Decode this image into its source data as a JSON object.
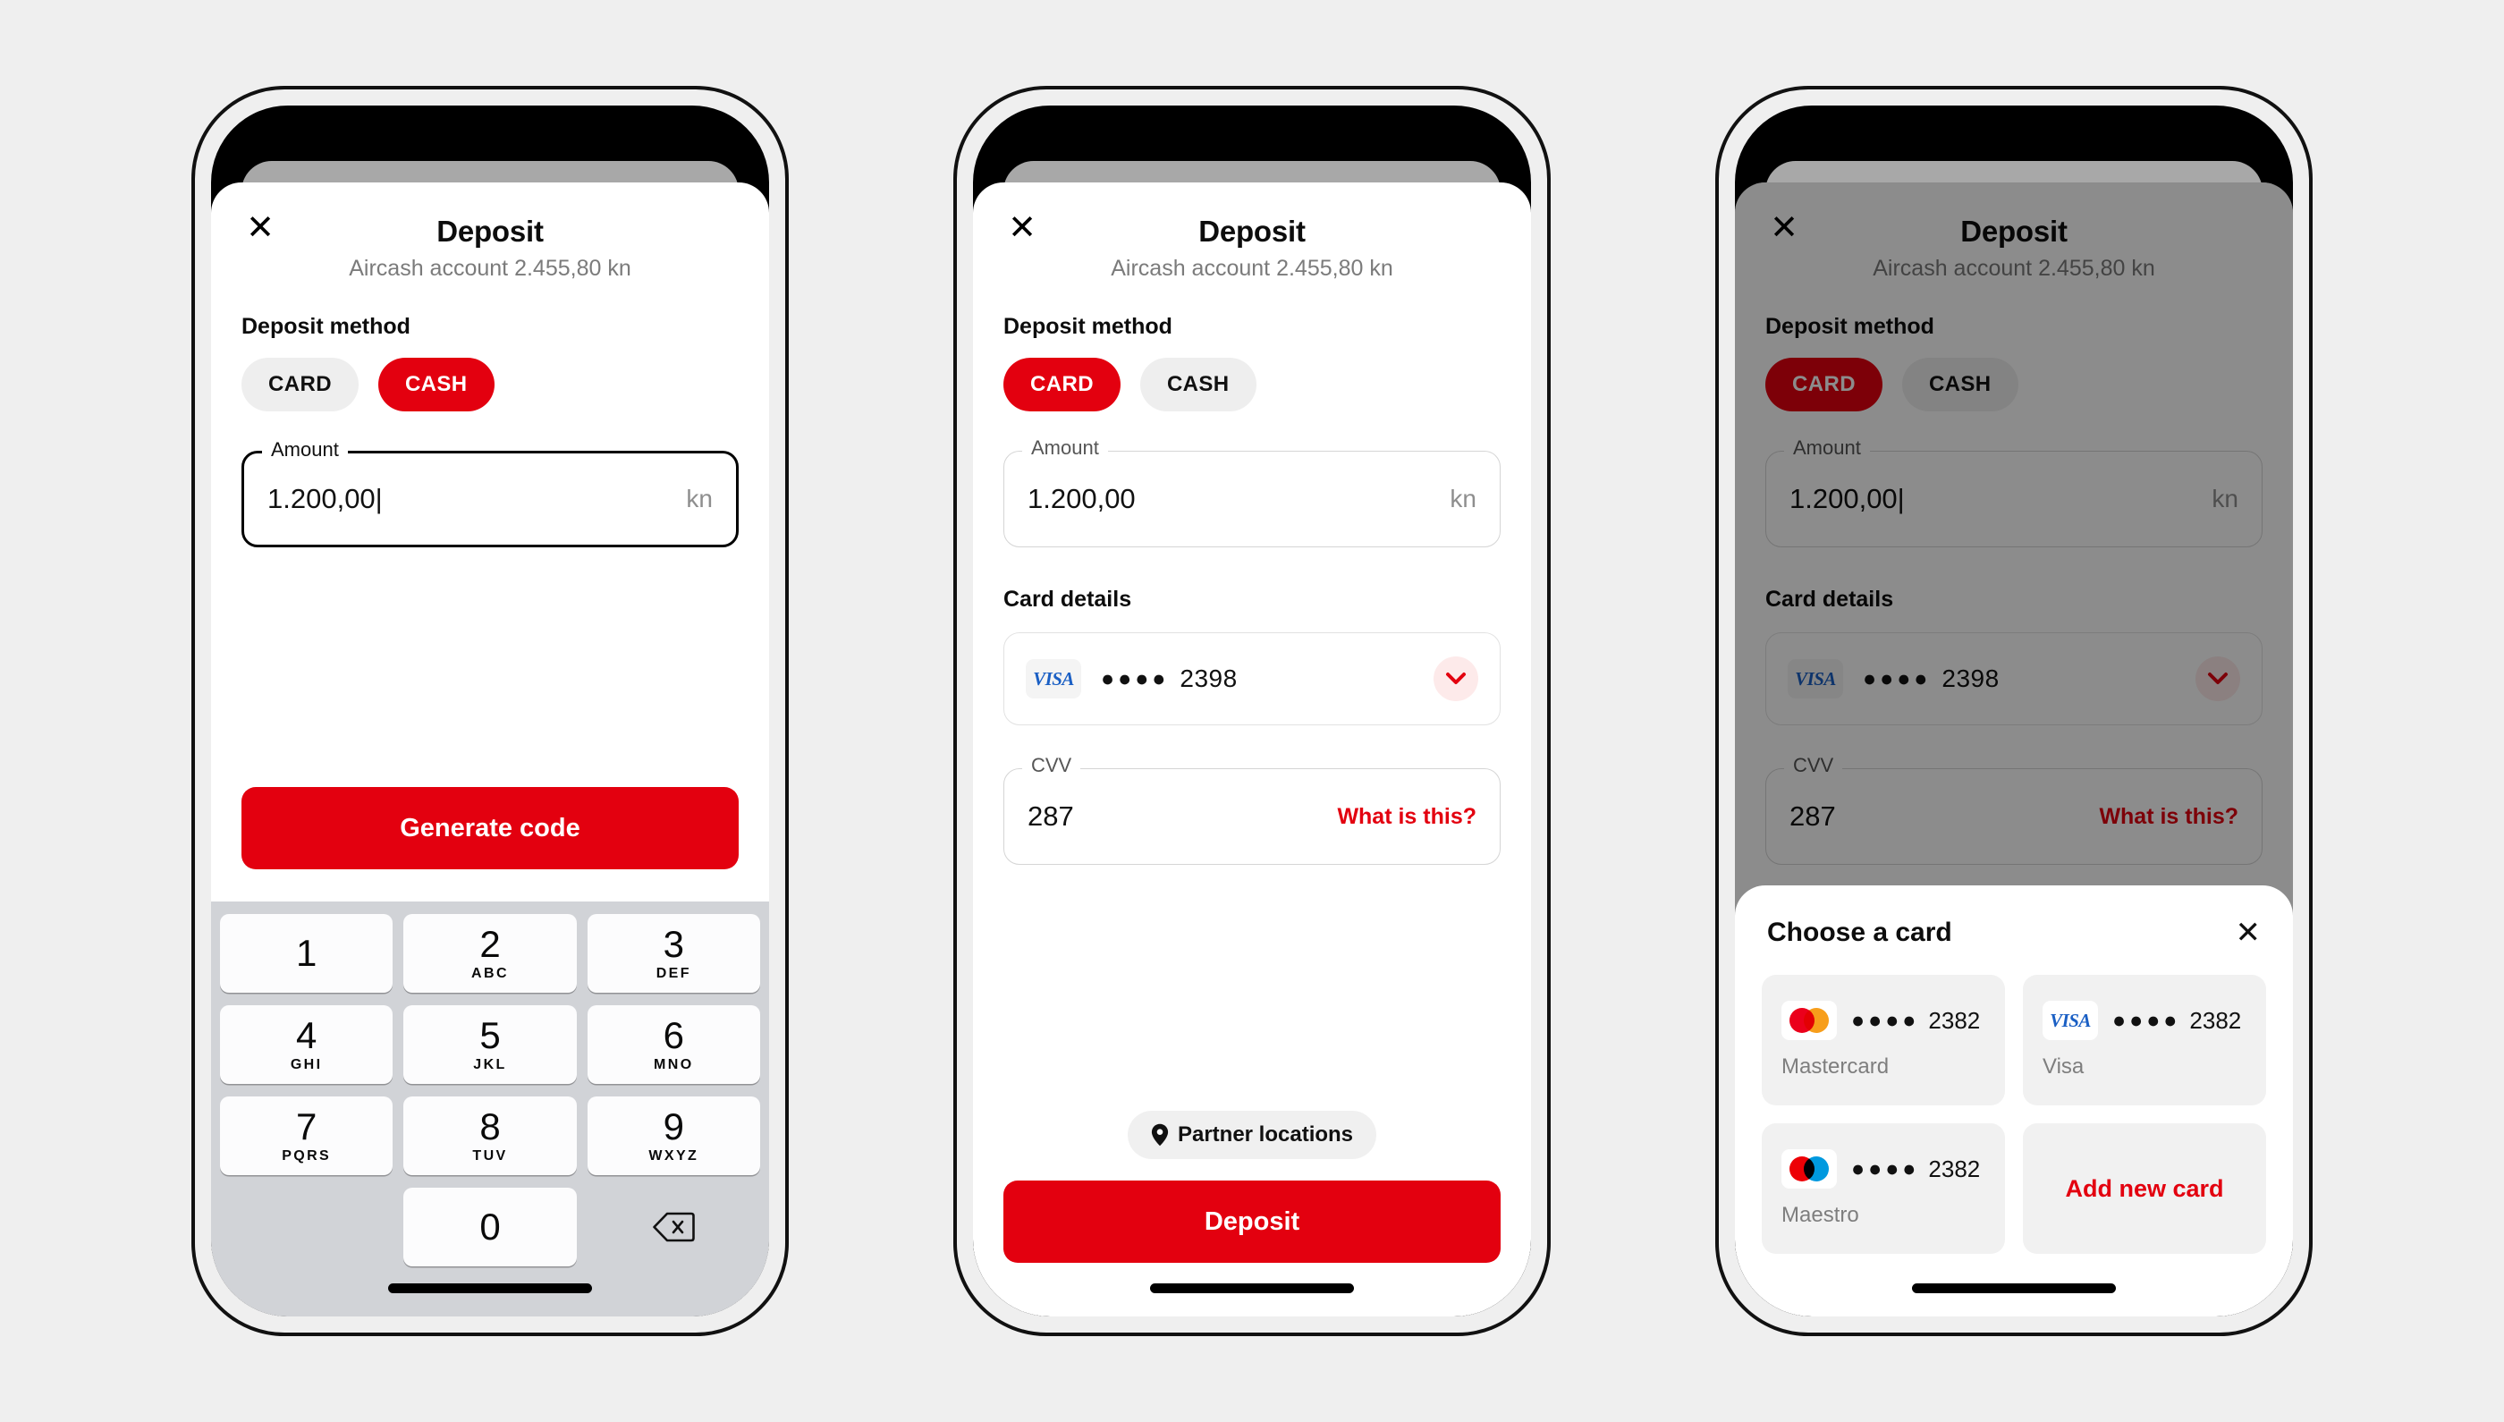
{
  "screens": [
    {
      "id": "cash",
      "header": {
        "close_icon": "close-icon",
        "title": "Deposit",
        "subtitle": "Aircash account 2.455,80 kn"
      },
      "method": {
        "label": "Deposit method",
        "options": [
          "CARD",
          "CASH"
        ],
        "selected": "CASH"
      },
      "amount": {
        "legend": "Amount",
        "value": "1.200,00|",
        "suffix": "kn",
        "focused": true
      },
      "primary_button": "Generate code",
      "keypad": {
        "keys": [
          {
            "num": "1",
            "sub": ""
          },
          {
            "num": "2",
            "sub": "ABC"
          },
          {
            "num": "3",
            "sub": "DEF"
          },
          {
            "num": "4",
            "sub": "GHI"
          },
          {
            "num": "5",
            "sub": "JKL"
          },
          {
            "num": "6",
            "sub": "MNO"
          },
          {
            "num": "7",
            "sub": "PQRS"
          },
          {
            "num": "8",
            "sub": "TUV"
          },
          {
            "num": "9",
            "sub": "WXYZ"
          },
          {
            "num": "0",
            "sub": ""
          }
        ],
        "delete_icon": "backspace-icon"
      }
    },
    {
      "id": "card",
      "header": {
        "close_icon": "close-icon",
        "title": "Deposit",
        "subtitle": "Aircash account 2.455,80 kn"
      },
      "method": {
        "label": "Deposit method",
        "options": [
          "CARD",
          "CASH"
        ],
        "selected": "CARD"
      },
      "amount": {
        "legend": "Amount",
        "value": "1.200,00",
        "suffix": "kn",
        "focused": false
      },
      "card_details": {
        "label": "Card details",
        "brand": "Visa",
        "brand_text": "VISA",
        "dots": "●●●●",
        "last4": "2398",
        "chevron_icon": "chevron-down-icon"
      },
      "cvv": {
        "legend": "CVV",
        "value": "287",
        "action": "What is this?"
      },
      "partner": {
        "icon": "map-pin-icon",
        "label": "Partner locations"
      },
      "primary_button": "Deposit"
    },
    {
      "id": "chooser",
      "header": {
        "close_icon": "close-icon",
        "title": "Deposit",
        "subtitle": "Aircash account 2.455,80 kn"
      },
      "method": {
        "label": "Deposit method",
        "options": [
          "CARD",
          "CASH"
        ],
        "selected": "CARD"
      },
      "amount": {
        "legend": "Amount",
        "value": "1.200,00|",
        "suffix": "kn",
        "focused": false
      },
      "card_details": {
        "label": "Card details",
        "brand": "Visa",
        "brand_text": "VISA",
        "dots": "●●●●",
        "last4": "2398",
        "chevron_icon": "chevron-down-icon"
      },
      "cvv": {
        "legend": "CVV",
        "value": "287",
        "action": "What is this?"
      },
      "chooser_sheet": {
        "title": "Choose a card",
        "close_icon": "close-icon",
        "cards": [
          {
            "brand": "Mastercard",
            "brand_text": "",
            "dots": "●●●●",
            "last4": "2382",
            "logo": "mastercard-logo"
          },
          {
            "brand": "Visa",
            "brand_text": "VISA",
            "dots": "●●●●",
            "last4": "2382",
            "logo": "visa-logo"
          },
          {
            "brand": "Maestro",
            "brand_text": "",
            "dots": "●●●●",
            "last4": "2382",
            "logo": "maestro-logo"
          }
        ],
        "add_card_label": "Add new card"
      }
    }
  ],
  "colors": {
    "brand_red": "#e3000f",
    "page_bg": "#efefef",
    "chip_bg": "#eeeeee",
    "keypad_bg": "#d1d3d7",
    "visa_blue": "#1a5fc4",
    "mc_red": "#eb001b",
    "mc_orange": "#f79e1b",
    "maestro_red": "#ed0006",
    "maestro_blue": "#0099df",
    "scrim": "rgba(0,0,0,0.45)"
  }
}
